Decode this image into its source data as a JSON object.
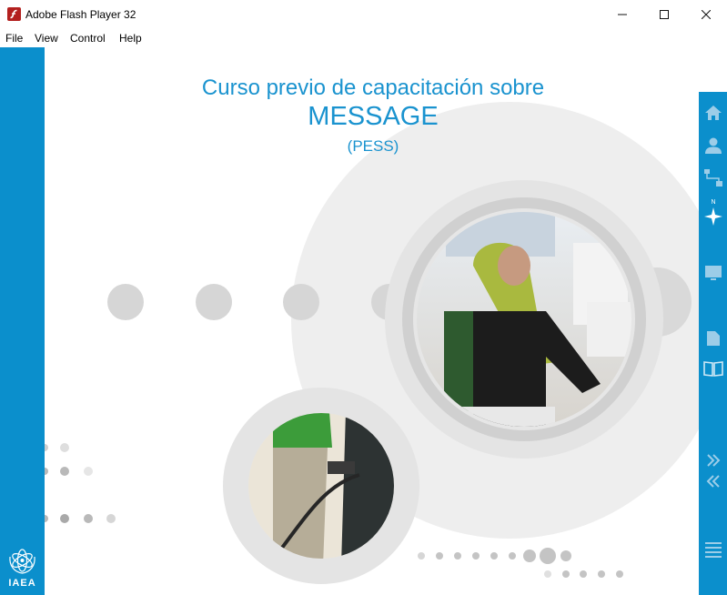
{
  "window": {
    "title": "Adobe Flash Player 32",
    "controls": {
      "minimize": "—",
      "maximize": "☐",
      "close": "✕"
    }
  },
  "menu": [
    "File",
    "View",
    "Control",
    "Help"
  ],
  "content": {
    "title_line1": "Curso previo de capacitación sobre",
    "title_line2": "MESSAGE",
    "title_line3": "(PESS)"
  },
  "logo": {
    "text": "IAEA"
  },
  "right_nav": {
    "icons": [
      "home-icon",
      "person-icon",
      "diagram-icon",
      "compass-icon",
      "monitor-icon",
      "document-icon",
      "book-icon",
      "forward-icon",
      "back-icon",
      "list-icon"
    ],
    "compass_label": "N"
  },
  "colors": {
    "accent": "#0b8fcc",
    "title": "#1a93cf",
    "circle": "#e2e2e2",
    "dot": "#b9b9b9"
  }
}
